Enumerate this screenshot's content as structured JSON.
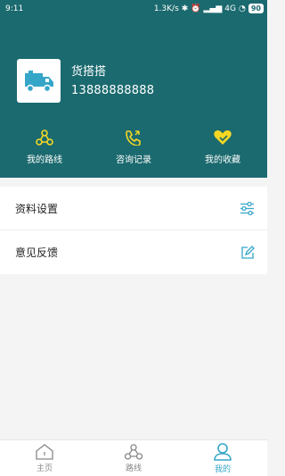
{
  "statusbar": {
    "time": "9:11",
    "network": "1.3K/s",
    "signal": "4G",
    "battery": "90"
  },
  "profile": {
    "name": "货搭搭",
    "phone": "13888888888"
  },
  "shortcuts": [
    {
      "label": "我的路线",
      "icon": "route-icon"
    },
    {
      "label": "咨询记录",
      "icon": "phone-icon"
    },
    {
      "label": "我的收藏",
      "icon": "heart-icon"
    }
  ],
  "menu": [
    {
      "label": "资料设置",
      "icon": "settings-sliders-icon"
    },
    {
      "label": "意见反馈",
      "icon": "edit-icon"
    }
  ],
  "tabbar": [
    {
      "label": "主页",
      "icon": "home-icon",
      "active": false
    },
    {
      "label": "路线",
      "icon": "route-icon",
      "active": false
    },
    {
      "label": "我的",
      "icon": "user-icon",
      "active": true
    }
  ],
  "colors": {
    "header": "#1b6a6f",
    "accent_yellow": "#f5d723",
    "accent_blue": "#35a6c8"
  }
}
